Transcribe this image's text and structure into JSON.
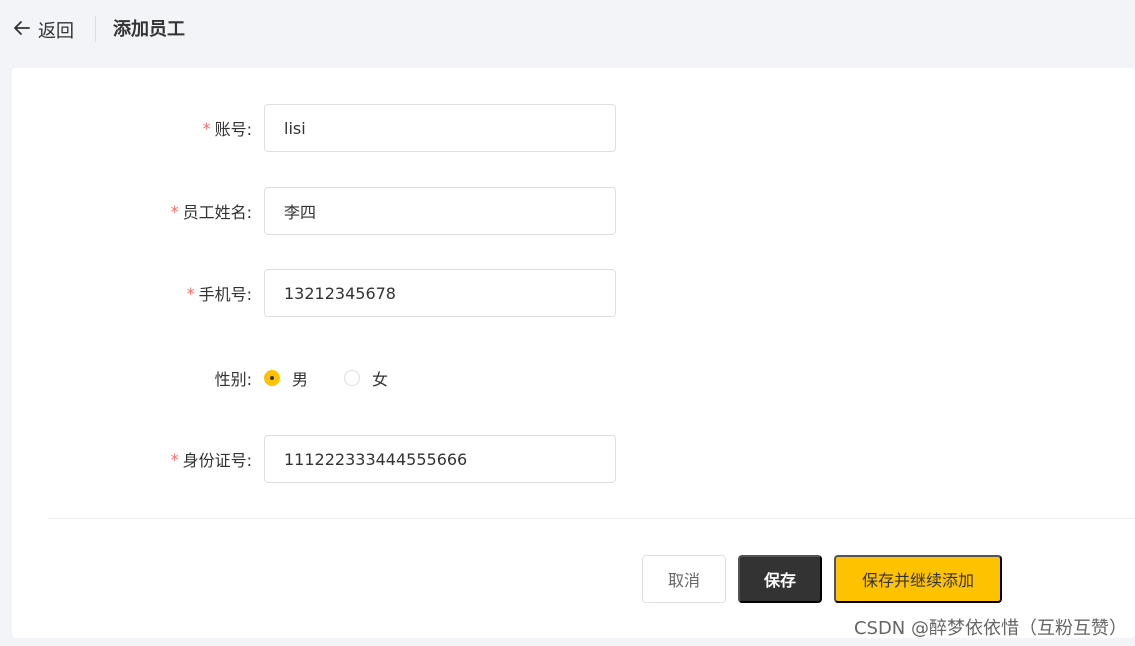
{
  "header": {
    "back_label": "返回",
    "title": "添加员工"
  },
  "form": {
    "required_mark": "*",
    "fields": [
      {
        "label": "账号:",
        "value": "lisi",
        "required": true
      },
      {
        "label": "员工姓名:",
        "value": "李四",
        "required": true
      },
      {
        "label": "手机号:",
        "value": "13212345678",
        "required": true
      },
      {
        "label": "身份证号:",
        "value": "111222333444555666",
        "required": true
      }
    ],
    "gender": {
      "label": "性别:",
      "options": [
        "男",
        "女"
      ],
      "selected": "男"
    }
  },
  "actions": {
    "cancel": "取消",
    "save": "保存",
    "save_continue": "保存并继续添加"
  },
  "watermark": "CSDN @醉梦依依惜（互粉互赞）",
  "colors": {
    "accent": "#ffc200",
    "dark_button": "#333333",
    "required": "#f56c6c"
  },
  "icons": {
    "back": "arrow-left-icon"
  }
}
